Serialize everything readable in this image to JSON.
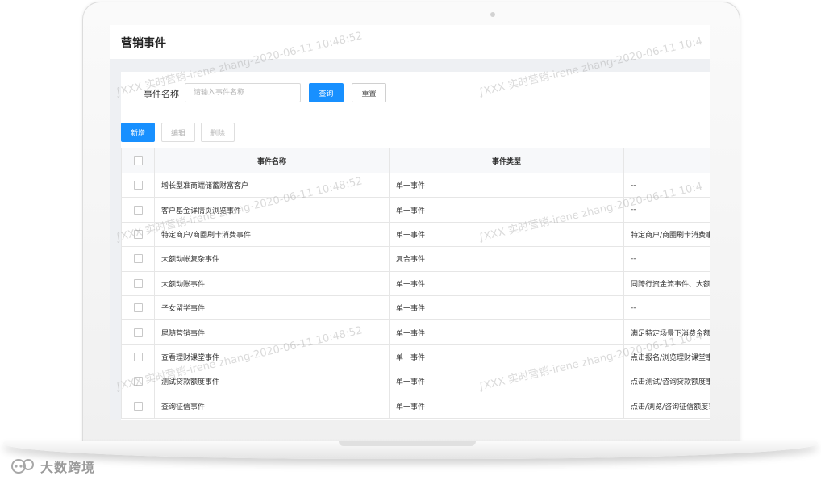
{
  "page": {
    "title": "营销事件"
  },
  "filter": {
    "label": "事件名称",
    "placeholder": "请输入事件名称",
    "search_label": "查询",
    "reset_label": "重置"
  },
  "toolbar": {
    "add_label": "新增",
    "edit_label": "编辑",
    "delete_label": "删除"
  },
  "table": {
    "columns": [
      "事件名称",
      "事件类型",
      ""
    ],
    "rows": [
      {
        "name": "增长型准商端储蓄财富客户",
        "type": "单一事件",
        "desc": "--"
      },
      {
        "name": "客户基金详情页浏览事件",
        "type": "单一事件",
        "desc": "--"
      },
      {
        "name": "特定商户/商圈刷卡消费事件",
        "type": "单一事件",
        "desc": "特定商户/商圈刷卡消费事"
      },
      {
        "name": "大额动帐复杂事件",
        "type": "复合事件",
        "desc": "--"
      },
      {
        "name": "大额动账事件",
        "type": "单一事件",
        "desc": "同跨行资金流事件、大额"
      },
      {
        "name": "子女留学事件",
        "type": "单一事件",
        "desc": "--"
      },
      {
        "name": "尾随营销事件",
        "type": "单一事件",
        "desc": "满足特定场景下消费金额"
      },
      {
        "name": "查看理财课堂事件",
        "type": "单一事件",
        "desc": "点击报名/浏览理财课堂事"
      },
      {
        "name": "测试贷款额度事件",
        "type": "单一事件",
        "desc": "点击测试/咨询贷款额度事"
      },
      {
        "name": "查询征信事件",
        "type": "单一事件",
        "desc": "点击/浏览/咨询征信额度事"
      }
    ]
  },
  "watermark": {
    "left": "∫XXX 实时营销-irene zhang-2020-06-11 10:48:52",
    "right": "∫XXX 实时营销-irene zhang-2020-06-11 10:4"
  },
  "brand": {
    "text": "大数跨境"
  },
  "colors": {
    "primary": "#1890ff",
    "background": "#eef0f3"
  }
}
